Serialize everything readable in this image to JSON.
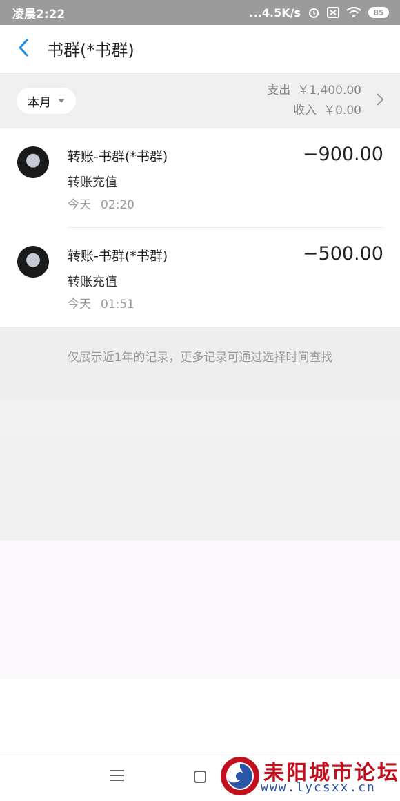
{
  "status_bar": {
    "time": "凌晨2:22",
    "network_speed": "...4.5K/s",
    "battery": "85",
    "icons": [
      "alarm-icon",
      "sim-icon",
      "wifi-icon",
      "battery-icon"
    ]
  },
  "header": {
    "back_icon": "chevron-left-icon",
    "title": "书群(*书群)",
    "accent_color": "#1f8ee8"
  },
  "filter": {
    "month_label": "本月",
    "expense_label": "支出",
    "expense_value": "￥1,400.00",
    "income_label": "收入",
    "income_value": "￥0.00"
  },
  "transactions": [
    {
      "name": "转账-书群(*书群)",
      "type": "转账充值",
      "day": "今天",
      "time": "02:20",
      "amount": "−900.00"
    },
    {
      "name": "转账-书群(*书群)",
      "type": "转账充值",
      "day": "今天",
      "time": "01:51",
      "amount": "−500.00"
    }
  ],
  "note": "仅展示近1年的记录，更多记录可通过选择时间查找",
  "watermark": {
    "text": "耒阳城市论坛",
    "url": "www.lycsxx.cn"
  }
}
